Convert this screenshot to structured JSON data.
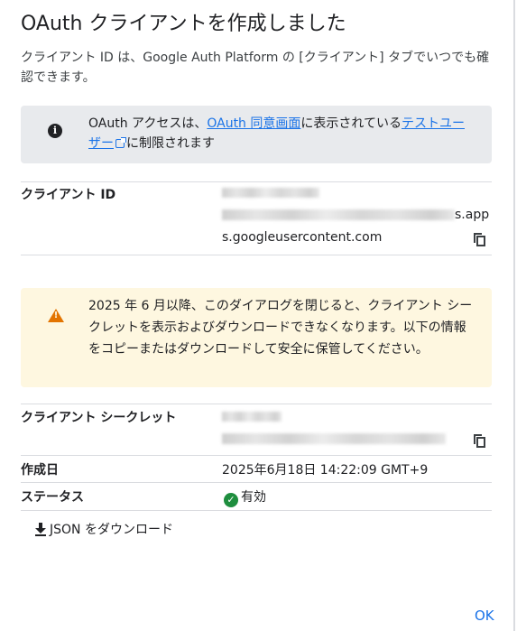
{
  "dialog": {
    "title": "OAuth クライアントを作成しました",
    "description": "クライアント ID は、Google Auth Platform の [クライアント] タブでいつでも確認できます。",
    "info": {
      "prefix": "OAuth アクセスは、",
      "link1": "OAuth 同意画面",
      "middle": "に表示されている",
      "link2": "テストユーザー",
      "suffix": "に制限されます"
    },
    "client_id": {
      "label": "クライアント ID",
      "value_tail_line2": "s.app",
      "value_line3": "s.googleusercontent.com"
    },
    "warning": {
      "text": "2025 年 6 月以降、このダイアログを閉じると、クライアント シークレットを表示およびダウンロードできなくなります。以下の情報をコピーまたはダウンロードして安全に保管してください。"
    },
    "client_secret": {
      "label": "クライアント シークレット"
    },
    "created": {
      "label": "作成日",
      "value": "2025年6月18日 14:22:09 GMT+9"
    },
    "status": {
      "label": "ステータス",
      "value": "有効",
      "color": "#1e8e3e"
    },
    "download_label": "JSON をダウンロード",
    "ok_label": "OK"
  },
  "icons": {
    "info": "info-icon",
    "warning": "warning-icon",
    "copy": "copy-icon",
    "external": "external-link-icon",
    "status": "check-circle-icon",
    "download": "download-icon"
  },
  "colors": {
    "accent": "#1a73e8",
    "info_bg": "#e8eaed",
    "warning_bg": "#fef7e0",
    "warning_icon": "#e37400"
  }
}
